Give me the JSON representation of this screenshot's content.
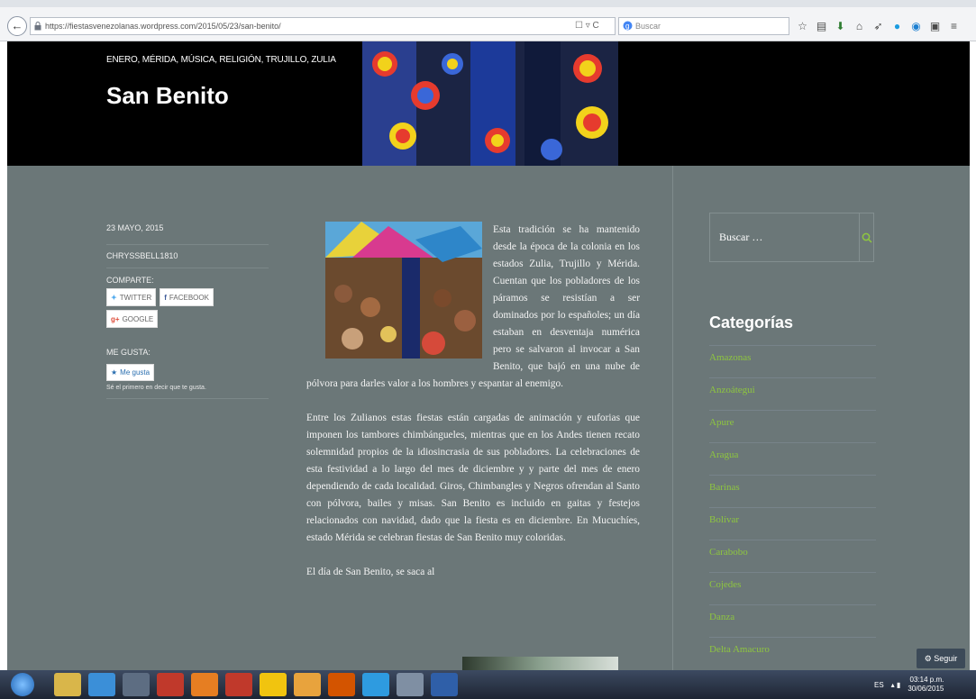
{
  "browser": {
    "url": "https://fiestasvenezolanas.wordpress.com/2015/05/23/san-benito/",
    "search_placeholder": "Buscar",
    "back": "←"
  },
  "header": {
    "categories": "ENERO, MÉRIDA, MÚSICA, RELIGIÓN, TRUJILLO, ZULIA",
    "title": "San Benito"
  },
  "meta": {
    "date": "23 MAYO, 2015",
    "author": "CHRYSSBELL1810",
    "share_label": "COMPARTE:",
    "twitter": "TWITTER",
    "facebook": "FACEBOOK",
    "google": "GOOGLE",
    "like_label": "ME GUSTA:",
    "like_button": "Me gusta",
    "like_note": "Sé el primero en decir que te gusta."
  },
  "article": {
    "p1": "Esta tradición se ha mantenido desde la época de la colonia en los estados Zulia, Trujillo y Mérida. Cuentan que los pobladores de los páramos se resistían a ser dominados por lo españoles; un día estaban en desventaja numérica pero se salvaron al invocar a San Benito, que bajó en una nube de pólvora para darles valor a los hombres y espantar al enemigo.",
    "p2": "Entre los Zulianos estas fiestas están cargadas de animación y euforias que imponen los tambores chimbángueles, mientras que en los Andes tienen recato solemnidad propios de la idiosincrasia de sus pobladores. La celebraciones de esta festividad a lo largo del mes de diciembre y y parte del mes de enero dependiendo de cada localidad. Giros, Chimbangles y Negros ofrendan al Santo con pólvora, bailes y misas. San Benito es incluido en gaitas y festejos relacionados con navidad, dado que la fiesta es en diciembre. En Mucuchíes, estado Mérida se celebran fiestas de San Benito muy coloridas.",
    "p3": "El día de San Benito, se saca al"
  },
  "sidebar": {
    "search_placeholder": "Buscar …",
    "categories_title": "Categorías",
    "categories": [
      "Amazonas",
      "Anzoátegui",
      "Apure",
      "Aragua",
      "Barinas",
      "Bolívar",
      "Carabobo",
      "Cojedes",
      "Danza",
      "Delta Amacuro"
    ]
  },
  "follow": "Seguir",
  "taskbar": {
    "lang": "ES",
    "time": "03:14 p.m.",
    "date": "30/06/2015"
  },
  "colors": {
    "accent": "#8ec63f",
    "content_bg": "#6b7778",
    "header_bg": "#000000"
  }
}
